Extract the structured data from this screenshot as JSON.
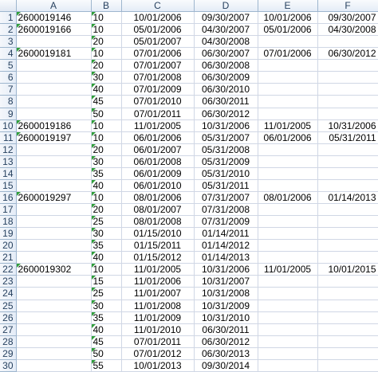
{
  "columns": [
    "A",
    "B",
    "C",
    "D",
    "E",
    "F"
  ],
  "rows": [
    {
      "n": "1",
      "a": "2600019146",
      "b": "10",
      "c": "10/01/2006",
      "d": "09/30/2007",
      "e": "10/01/2006",
      "f": "09/30/2007",
      "ta": true,
      "tb": true
    },
    {
      "n": "2",
      "a": "2600019166",
      "b": "10",
      "c": "05/01/2006",
      "d": "04/30/2007",
      "e": "05/01/2006",
      "f": "04/30/2008",
      "ta": true,
      "tb": true
    },
    {
      "n": "3",
      "a": "",
      "b": "20",
      "c": "05/01/2007",
      "d": "04/30/2008",
      "e": "",
      "f": "",
      "ta": false,
      "tb": true
    },
    {
      "n": "4",
      "a": "2600019181",
      "b": "10",
      "c": "07/01/2006",
      "d": "06/30/2007",
      "e": "07/01/2006",
      "f": "06/30/2012",
      "ta": true,
      "tb": true
    },
    {
      "n": "5",
      "a": "",
      "b": "20",
      "c": "07/01/2007",
      "d": "06/30/2008",
      "e": "",
      "f": "",
      "ta": false,
      "tb": true
    },
    {
      "n": "6",
      "a": "",
      "b": "30",
      "c": "07/01/2008",
      "d": "06/30/2009",
      "e": "",
      "f": "",
      "ta": false,
      "tb": true
    },
    {
      "n": "7",
      "a": "",
      "b": "40",
      "c": "07/01/2009",
      "d": "06/30/2010",
      "e": "",
      "f": "",
      "ta": false,
      "tb": true
    },
    {
      "n": "8",
      "a": "",
      "b": "45",
      "c": "07/01/2010",
      "d": "06/30/2011",
      "e": "",
      "f": "",
      "ta": false,
      "tb": true
    },
    {
      "n": "9",
      "a": "",
      "b": "50",
      "c": "07/01/2011",
      "d": "06/30/2012",
      "e": "",
      "f": "",
      "ta": false,
      "tb": true
    },
    {
      "n": "10",
      "a": "2600019186",
      "b": "10",
      "c": "11/01/2005",
      "d": "10/31/2006",
      "e": "11/01/2005",
      "f": "10/31/2006",
      "ta": true,
      "tb": true
    },
    {
      "n": "11",
      "a": "2600019197",
      "b": "10",
      "c": "06/01/2006",
      "d": "05/31/2007",
      "e": "06/01/2006",
      "f": "05/31/2011",
      "ta": true,
      "tb": true
    },
    {
      "n": "12",
      "a": "",
      "b": "20",
      "c": "06/01/2007",
      "d": "05/31/2008",
      "e": "",
      "f": "",
      "ta": false,
      "tb": true
    },
    {
      "n": "13",
      "a": "",
      "b": "30",
      "c": "06/01/2008",
      "d": "05/31/2009",
      "e": "",
      "f": "",
      "ta": false,
      "tb": true
    },
    {
      "n": "14",
      "a": "",
      "b": "35",
      "c": "06/01/2009",
      "d": "05/31/2010",
      "e": "",
      "f": "",
      "ta": false,
      "tb": true
    },
    {
      "n": "15",
      "a": "",
      "b": "40",
      "c": "06/01/2010",
      "d": "05/31/2011",
      "e": "",
      "f": "",
      "ta": false,
      "tb": true
    },
    {
      "n": "16",
      "a": "2600019297",
      "b": "10",
      "c": "08/01/2006",
      "d": "07/31/2007",
      "e": "08/01/2006",
      "f": "01/14/2013",
      "ta": true,
      "tb": true
    },
    {
      "n": "17",
      "a": "",
      "b": "20",
      "c": "08/01/2007",
      "d": "07/31/2008",
      "e": "",
      "f": "",
      "ta": false,
      "tb": true
    },
    {
      "n": "18",
      "a": "",
      "b": "25",
      "c": "08/01/2008",
      "d": "07/31/2009",
      "e": "",
      "f": "",
      "ta": false,
      "tb": true
    },
    {
      "n": "19",
      "a": "",
      "b": "30",
      "c": "01/15/2010",
      "d": "01/14/2011",
      "e": "",
      "f": "",
      "ta": false,
      "tb": true
    },
    {
      "n": "20",
      "a": "",
      "b": "35",
      "c": "01/15/2011",
      "d": "01/14/2012",
      "e": "",
      "f": "",
      "ta": false,
      "tb": true
    },
    {
      "n": "21",
      "a": "",
      "b": "40",
      "c": "01/15/2012",
      "d": "01/14/2013",
      "e": "",
      "f": "",
      "ta": false,
      "tb": true
    },
    {
      "n": "22",
      "a": "2600019302",
      "b": "10",
      "c": "11/01/2005",
      "d": "10/31/2006",
      "e": "11/01/2005",
      "f": "10/01/2015",
      "ta": true,
      "tb": true
    },
    {
      "n": "23",
      "a": "",
      "b": "15",
      "c": "11/01/2006",
      "d": "10/31/2007",
      "e": "",
      "f": "",
      "ta": false,
      "tb": true
    },
    {
      "n": "24",
      "a": "",
      "b": "25",
      "c": "11/01/2007",
      "d": "10/31/2008",
      "e": "",
      "f": "",
      "ta": false,
      "tb": true
    },
    {
      "n": "25",
      "a": "",
      "b": "30",
      "c": "11/01/2008",
      "d": "10/31/2009",
      "e": "",
      "f": "",
      "ta": false,
      "tb": true
    },
    {
      "n": "26",
      "a": "",
      "b": "35",
      "c": "11/01/2009",
      "d": "10/31/2010",
      "e": "",
      "f": "",
      "ta": false,
      "tb": true
    },
    {
      "n": "27",
      "a": "",
      "b": "40",
      "c": "11/01/2010",
      "d": "06/30/2011",
      "e": "",
      "f": "",
      "ta": false,
      "tb": true
    },
    {
      "n": "28",
      "a": "",
      "b": "45",
      "c": "07/01/2011",
      "d": "06/30/2012",
      "e": "",
      "f": "",
      "ta": false,
      "tb": true
    },
    {
      "n": "29",
      "a": "",
      "b": "50",
      "c": "07/01/2012",
      "d": "06/30/2013",
      "e": "",
      "f": "",
      "ta": false,
      "tb": true
    },
    {
      "n": "30",
      "a": "",
      "b": "55",
      "c": "10/01/2013",
      "d": "09/30/2014",
      "e": "",
      "f": "",
      "ta": false,
      "tb": true
    }
  ],
  "colors": {
    "grid": "#d0d7e5",
    "header_border": "#9eb6ce",
    "header_text": "#27415f",
    "error_indicator": "#2f9e3a"
  }
}
